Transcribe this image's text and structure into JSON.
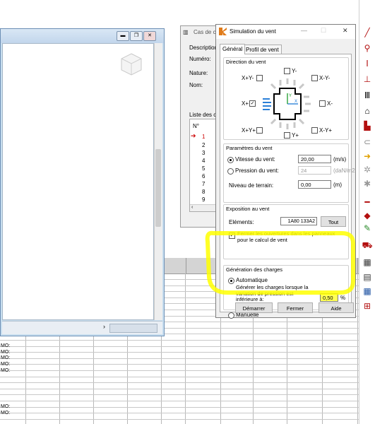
{
  "spreadsheet": {
    "row_labels": [
      "MO:",
      "MO:",
      "MO:",
      "MO:",
      "MO:",
      "MO:",
      "MO:"
    ]
  },
  "cas_dialog": {
    "title": "Cas de c",
    "fields": [
      "Description",
      "Numéro:",
      "Nature:",
      "Nom:"
    ],
    "list_title": "Liste des ca",
    "list_header": "N°",
    "list_items": [
      "1",
      "2",
      "3",
      "4",
      "5",
      "6",
      "7",
      "8",
      "9"
    ]
  },
  "dialog": {
    "title": "Simulation du vent",
    "tabs": [
      "Général",
      "Profil de vent"
    ],
    "direction": {
      "title": "Direction du vent",
      "labels": {
        "ym": "Y-",
        "xpy": "X+Y-",
        "xmym": "X-Y-",
        "xp": "X+",
        "xm": "X-",
        "xpyp": "X+Y+",
        "yp": "Y+",
        "xmyp": "X-Y+"
      },
      "checked": [
        "X+"
      ]
    },
    "params": {
      "title": "Paramètres du vent",
      "vitesse_label": "Vitesse du vent:",
      "vitesse_value": "20,00",
      "vitesse_unit": "(m/s)",
      "pression_label": "Pression du vent:",
      "pression_value": "24",
      "pression_unit": "(daN/m2",
      "niveau_label": "Niveau de terrain:",
      "niveau_value": "0,00",
      "niveau_unit": "(m)",
      "selected": "vitesse"
    },
    "exposition": {
      "title": "Exposition au vent",
      "elements_label": "Eléments:",
      "elements_value": "1A80 133A2",
      "tout_label": "Tout",
      "fermer_label": "Fermer les ouvertures dans les panneaux pour le calcul de vent",
      "fermer_checked": true
    },
    "generation": {
      "title": "Génération des charges",
      "auto_label": "Automatique",
      "desc": "Générer les charges lorsque la variation de pression est inférieure à:",
      "value": "0,50",
      "unit": "%",
      "manual_label": "Manuelle",
      "selected": "auto"
    },
    "buttons": {
      "demarrer": "Démarrer",
      "fermer": "Fermer",
      "aide": "Aide"
    }
  },
  "highlight_color": "#ffff00"
}
